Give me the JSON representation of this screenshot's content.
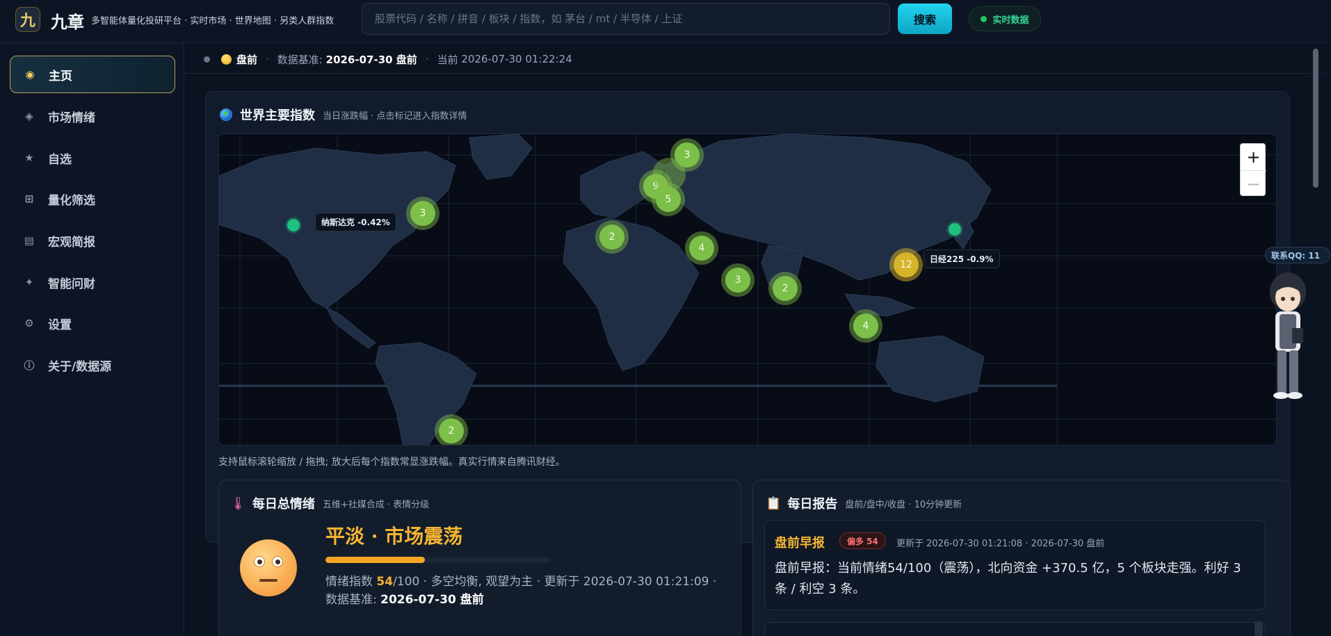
{
  "header": {
    "logo_char": "九",
    "title": "九章",
    "subtitle": "多智能体量化投研平台 · 实时市场 · 世界地图 · 另类人群指数",
    "search_placeholder": "股票代码 / 名称 / 拼音 / 板块 / 指数，如 茅台 / mt / 半导体 / 上证",
    "search_button": "搜索",
    "live_label": "实时数据"
  },
  "sidebar": {
    "items": [
      {
        "label": "主页",
        "icon": "radio-dot-icon",
        "glyph": "◉",
        "active": true
      },
      {
        "label": "市场情绪",
        "icon": "diamond-icon",
        "glyph": "◈",
        "active": false
      },
      {
        "label": "自选",
        "icon": "star-icon",
        "glyph": "★",
        "active": false
      },
      {
        "label": "量化筛选",
        "icon": "grid-icon",
        "glyph": "⊞",
        "active": false
      },
      {
        "label": "宏观简报",
        "icon": "list-icon",
        "glyph": "▤",
        "active": false
      },
      {
        "label": "智能问财",
        "icon": "sparkle-icon",
        "glyph": "✦",
        "active": false
      },
      {
        "label": "设置",
        "icon": "gear-icon",
        "glyph": "⚙",
        "active": false
      },
      {
        "label": "关于/数据源",
        "icon": "info-icon",
        "glyph": "ⓘ",
        "active": false
      }
    ]
  },
  "status": {
    "session": "盘前",
    "basis_label": "数据基准:",
    "basis_value": "2026-07-30 盘前",
    "current_label": "当前",
    "current_time": "2026-07-30 01:22:24"
  },
  "world_map": {
    "title": "世界主要指数",
    "subtitle": "当日涨跌幅 · 点击标记进入指数详情",
    "clusters": [
      "3",
      "9",
      "5",
      "3",
      "2",
      "4",
      "3",
      "2",
      "4",
      "2",
      "12"
    ],
    "labels": {
      "nasdaq": "纳斯达克 -0.42%",
      "nikkei": "日经225 -0.9%"
    },
    "zoom_in": "+",
    "zoom_out": "−",
    "note": "支持鼠标滚轮缩放 / 拖拽; 放大后每个指数常显涨跌幅。真实行情来自腾讯财经。"
  },
  "sentiment": {
    "title": "每日总情绪",
    "subtitle": "五维+社媒合成 · 表情分级",
    "mood": "平淡 · 市场震荡",
    "bar_fraction": 0.44,
    "index_label": "情绪指数",
    "score": "54",
    "score_max": "/100",
    "desc": "· 多空均衡, 观望为主 · 更新于 2026-07-30 01:21:09 · 数据基准:",
    "basis": "2026-07-30 盘前"
  },
  "report": {
    "title": "每日报告",
    "subtitle": "盘前/盘中/收盘 · 10分钟更新",
    "item_title": "盘前早报",
    "badge": "偏多 54",
    "meta": "更新于 2026-07-30 01:21:08 · 2026-07-30 盘前",
    "text": "盘前早报：当前情绪54/100（震荡），北向资金 +370.5 亿，5 个板块走强。利好 3 条 / 利空 3 条。"
  },
  "contact": {
    "label": "联系QQ: 11"
  },
  "colors": {
    "accent_gold": "#f5b532",
    "accent_cyan": "#22d3ee",
    "cluster_green": "#7cc04a",
    "cluster_gold": "#d6b428",
    "live_green": "#22c55e"
  }
}
